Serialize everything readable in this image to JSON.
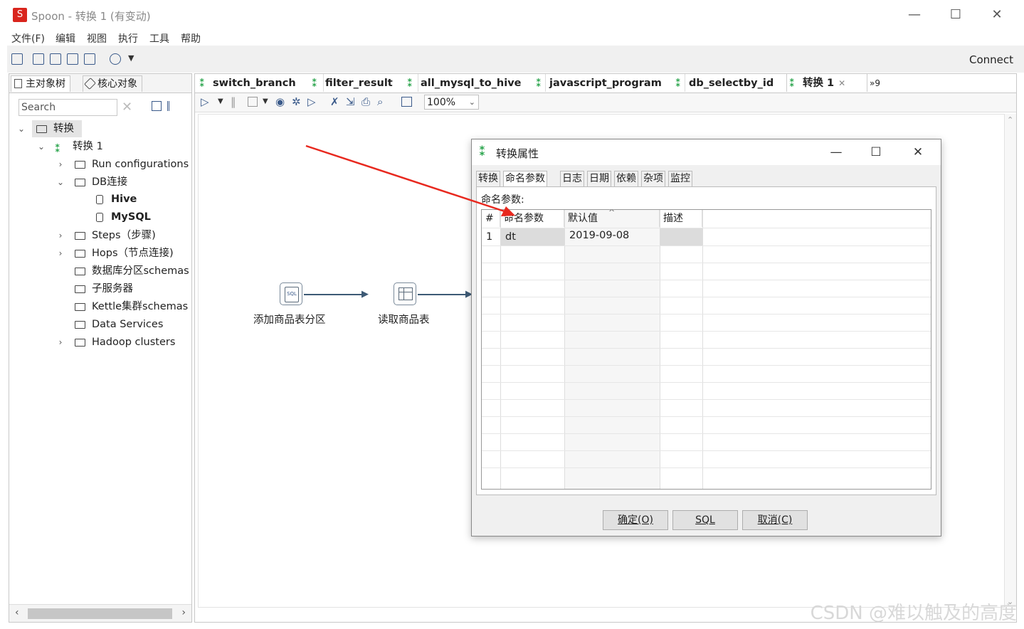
{
  "window": {
    "title": "Spoon - 转换 1 (有变动)",
    "logo": "S"
  },
  "menu": [
    "文件(F)",
    "编辑",
    "视图",
    "执行",
    "工具",
    "帮助"
  ],
  "toolbar": {
    "connect_label": "Connect"
  },
  "left_panel": {
    "tabs": [
      "主对象树",
      "核心对象"
    ],
    "search_placeholder": "Search",
    "tree": {
      "root": "转换",
      "transformation": "转换 1",
      "items": [
        {
          "label": "Run configurations"
        },
        {
          "label": "DB连接"
        },
        {
          "label": "Hive"
        },
        {
          "label": "MySQL"
        },
        {
          "label": "Steps（步骤)"
        },
        {
          "label": "Hops（节点连接)"
        },
        {
          "label": "数据库分区schemas"
        },
        {
          "label": "子服务器"
        },
        {
          "label": "Kettle集群schemas"
        },
        {
          "label": "Data Services"
        },
        {
          "label": "Hadoop clusters"
        }
      ]
    }
  },
  "file_tabs": [
    "switch_branch",
    "filter_result",
    "all_mysql_to_hive",
    "javascript_program",
    "db_selectby_id",
    "转换 1"
  ],
  "file_tabs_overflow": "»9",
  "canvas": {
    "zoom": "100%",
    "steps": [
      {
        "label": "添加商品表分区",
        "icon": "sql-script-icon"
      },
      {
        "label": "读取商品表",
        "icon": "table-input-icon"
      }
    ]
  },
  "dialog": {
    "title": "转换属性",
    "tabs": [
      "转换",
      "命名参数",
      "日志",
      "日期",
      "依赖",
      "杂项",
      "监控"
    ],
    "section_label": "命名参数:",
    "table": {
      "headers": [
        "#",
        "命名参数",
        "默认值",
        "描述"
      ],
      "rows": [
        {
          "num": "1",
          "name": "dt",
          "default": "2019-09-08",
          "desc": ""
        }
      ]
    },
    "buttons": {
      "ok": "确定(O)",
      "sql": "SQL",
      "cancel": "取消(C)"
    }
  },
  "watermark": "CSDN @难以触及的高度",
  "colors": {
    "accent_green": "#27a34a",
    "arrow_red": "#e8281e",
    "logo_red": "#d9251d"
  }
}
